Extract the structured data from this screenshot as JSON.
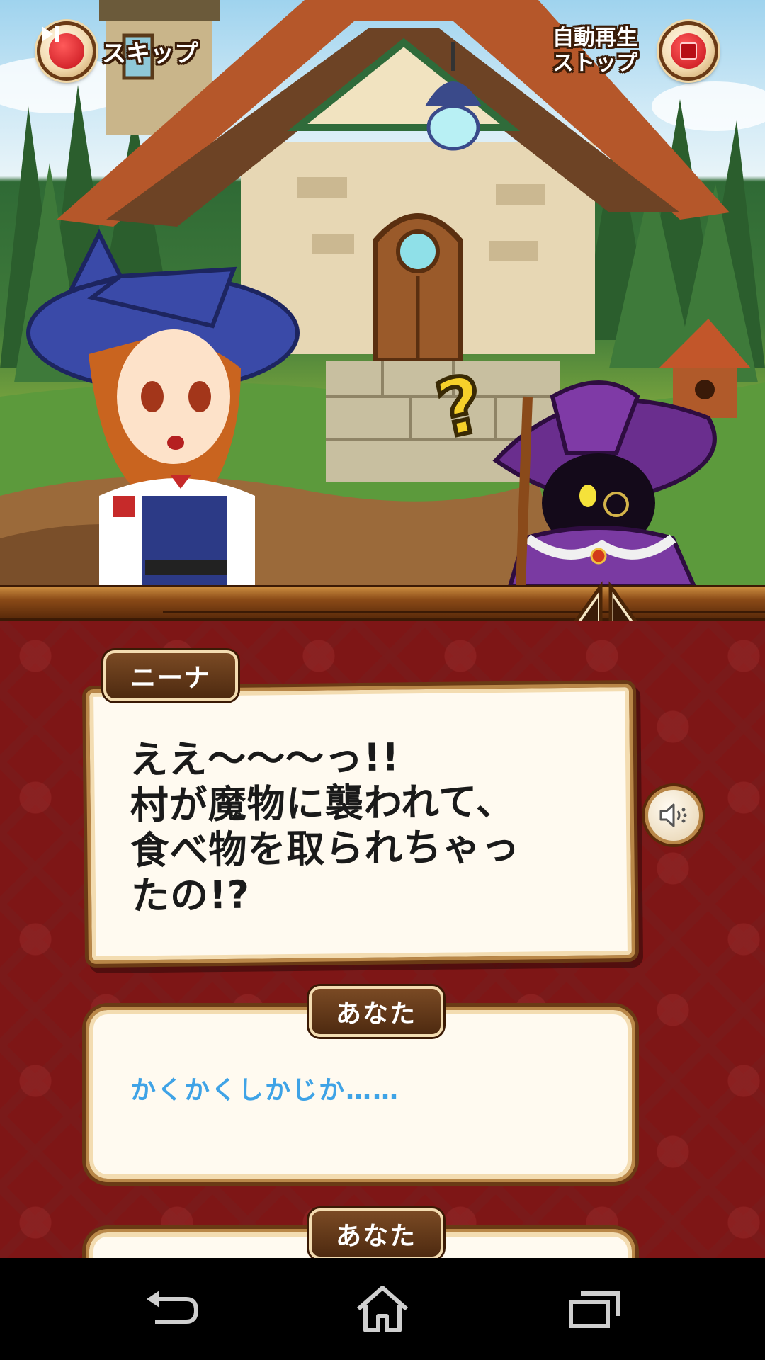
{
  "top_bar": {
    "skip_label": "スキップ",
    "auto_play_stop_label": "自動再生\nストップ"
  },
  "dialogue": {
    "speaker_name": "ニーナ",
    "message": "ええ〜〜〜っ!!\n村が魔物に襲われて、\n食べ物を取られちゃっ\nたの!?"
  },
  "choices": [
    {
      "speaker": "あなた",
      "text": "かくかくしかじか……"
    },
    {
      "speaker": "あなた",
      "text": ""
    }
  ],
  "colors": {
    "dialogue_background": "#7e1616",
    "choice_text": "#3fa3e6",
    "frame_brown": "#6a3a15",
    "paper": "#fffaf0"
  },
  "icons": {
    "skip": "skip-forward-icon",
    "stop": "stop-icon",
    "voice": "speaker-icon",
    "collapse": "collapse-arrows-icon",
    "back": "back-icon",
    "home": "home-icon",
    "recents": "recents-icon"
  }
}
